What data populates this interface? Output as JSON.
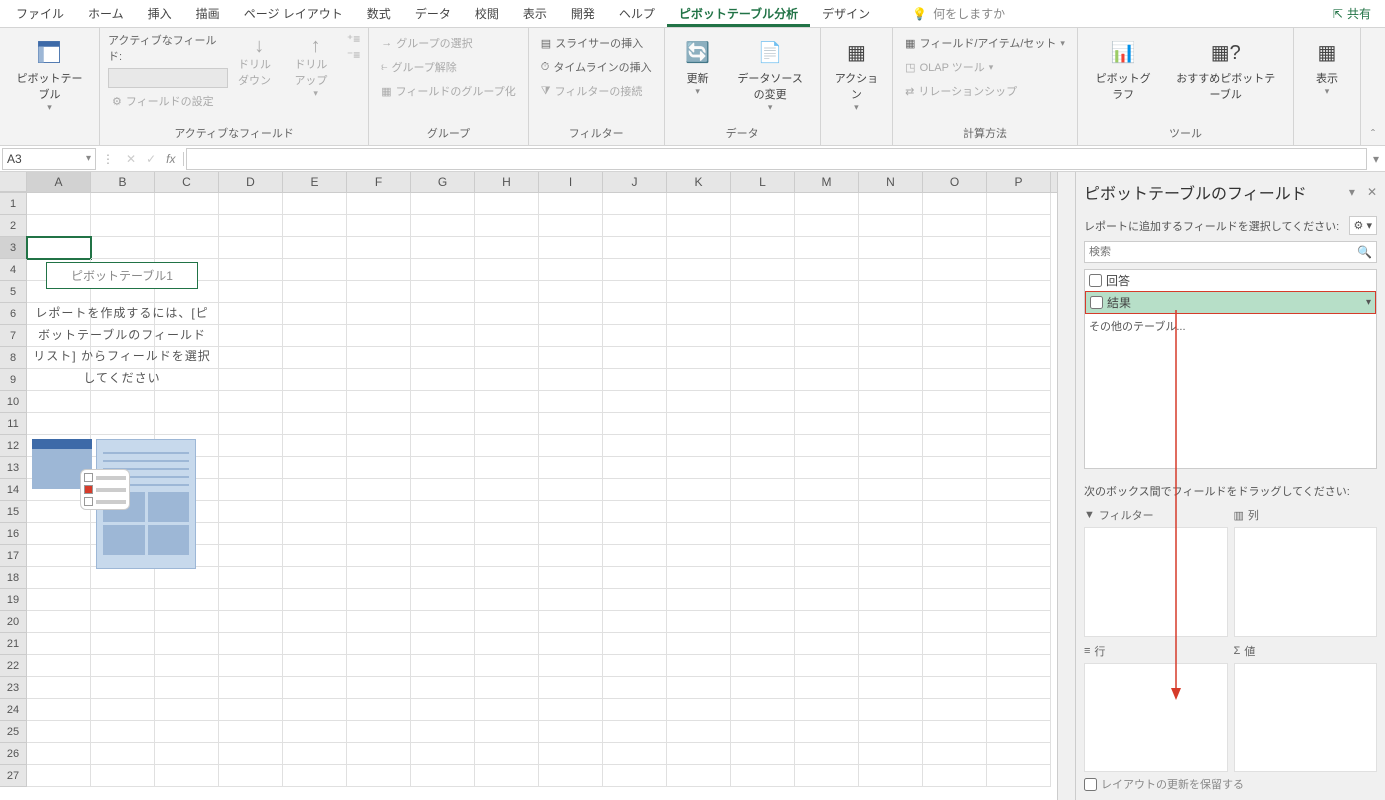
{
  "tabs": {
    "file": "ファイル",
    "home": "ホーム",
    "insert": "挿入",
    "draw": "描画",
    "page_layout": "ページ レイアウト",
    "formulas": "数式",
    "data": "データ",
    "review": "校閲",
    "view": "表示",
    "developer": "開発",
    "help": "ヘルプ",
    "pivot_analyze": "ピボットテーブル分析",
    "design": "デザイン",
    "tell_me": "何をしますか",
    "share": "共有"
  },
  "ribbon": {
    "pivot_table_btn": "ピボットテーブル",
    "active_field_label": "アクティブなフィールド:",
    "drill_down": "ドリルダウン",
    "drill_up": "ドリルアップ",
    "field_settings": "フィールドの設定",
    "group_active_field": "アクティブなフィールド",
    "group_selection": "グループの選択",
    "ungroup": "グループ解除",
    "group_field": "フィールドのグループ化",
    "group_group": "グループ",
    "insert_slicer": "スライサーの挿入",
    "insert_timeline": "タイムラインの挿入",
    "filter_connections": "フィルターの接続",
    "group_filter": "フィルター",
    "refresh": "更新",
    "change_source": "データソースの変更",
    "group_data": "データ",
    "actions": "アクション",
    "fields_items_sets": "フィールド/アイテム/セット",
    "olap_tools": "OLAP ツール",
    "relationships": "リレーションシップ",
    "group_calc": "計算方法",
    "pivot_chart": "ピボットグラフ",
    "recommended": "おすすめピボットテーブル",
    "group_tools": "ツール",
    "show": "表示"
  },
  "formula_bar": {
    "name_box": "A3",
    "fx": "fx"
  },
  "grid": {
    "columns": [
      "A",
      "B",
      "C",
      "D",
      "E",
      "F",
      "G",
      "H",
      "I",
      "J",
      "K",
      "L",
      "M",
      "N",
      "O",
      "P"
    ],
    "row_count": 27,
    "selected_cell": "A3"
  },
  "pivot_placeholder": {
    "title": "ピボットテーブル1",
    "instruction": "レポートを作成するには、[ピボットテーブルのフィールドリスト] からフィールドを選択してください"
  },
  "field_pane": {
    "title": "ピボットテーブルのフィールド",
    "subtitle": "レポートに追加するフィールドを選択してください:",
    "search_placeholder": "検索",
    "fields": {
      "answer": "回答",
      "result": "結果"
    },
    "other_tables": "その他のテーブル...",
    "drag_label": "次のボックス間でフィールドをドラッグしてください:",
    "areas": {
      "filters": "フィルター",
      "columns": "列",
      "rows": "行",
      "values": "値"
    },
    "defer_update": "レイアウトの更新を保留する"
  }
}
